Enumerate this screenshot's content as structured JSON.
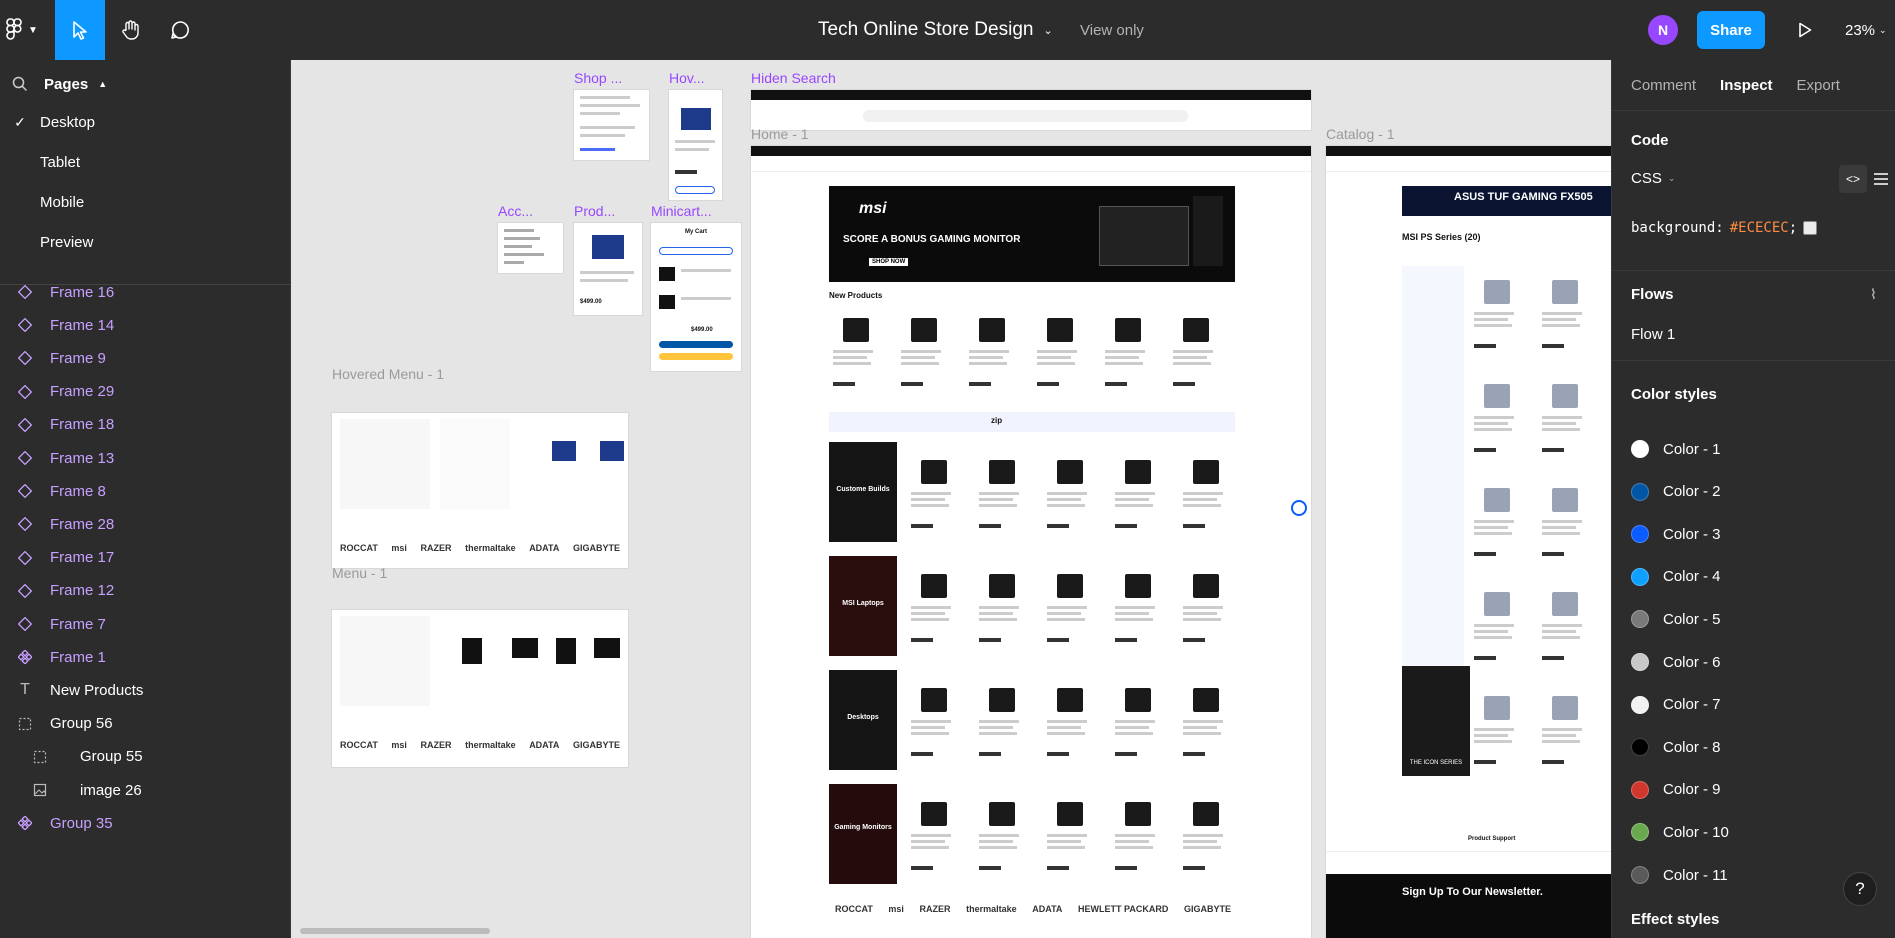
{
  "toolbar": {
    "title": "Tech Online Store Design",
    "view_mode": "View only",
    "avatar_initial": "N",
    "share_label": "Share",
    "zoom": "23%"
  },
  "pages": {
    "header": "Pages",
    "items": [
      "Desktop",
      "Tablet",
      "Mobile",
      "Preview"
    ],
    "selected": "Desktop"
  },
  "layers": [
    {
      "label": "Frame 16",
      "type": "frame"
    },
    {
      "label": "Frame 14",
      "type": "frame"
    },
    {
      "label": "Frame 9",
      "type": "frame"
    },
    {
      "label": "Frame 29",
      "type": "frame"
    },
    {
      "label": "Frame 18",
      "type": "frame"
    },
    {
      "label": "Frame 13",
      "type": "frame"
    },
    {
      "label": "Frame 8",
      "type": "frame"
    },
    {
      "label": "Frame 28",
      "type": "frame"
    },
    {
      "label": "Frame 17",
      "type": "frame"
    },
    {
      "label": "Frame 12",
      "type": "frame"
    },
    {
      "label": "Frame 7",
      "type": "frame"
    },
    {
      "label": "Frame 1",
      "type": "component"
    },
    {
      "label": "New Products",
      "type": "text"
    },
    {
      "label": "Group 56",
      "type": "group"
    },
    {
      "label": "Group 55",
      "type": "group"
    },
    {
      "label": "image 26",
      "type": "image"
    },
    {
      "label": "Group 35",
      "type": "component"
    }
  ],
  "canvas": {
    "labels": {
      "shop": "Shop ...",
      "hov": "Hov...",
      "hidden_search": "Hiden Search",
      "home": "Home - 1",
      "catalog": "Catalog - 1",
      "acc": "Acc...",
      "prod": "Prod...",
      "minicart": "Minicart...",
      "hovered_menu": "Hovered Menu - 1",
      "menu": "Menu - 1"
    },
    "home": {
      "banner_brand": "msi",
      "banner_headline": "SCORE A BONUS GAMING MONITOR",
      "banner_cta": "SHOP NOW",
      "new_products": "New Products",
      "custom_builds": "Custome Builds",
      "msi_laptops": "MSI Laptops",
      "desktops": "Desktops",
      "gaming_monitors": "Gaming Monitors",
      "zip_text": "zip"
    },
    "catalog": {
      "banner": "ASUS TUF GAMING FX505",
      "heading": "MSI PS Series (20)",
      "newsletter": "Sign Up To Our Newsletter.",
      "product_support": "Product Support",
      "icon_series": "THE ICON SERIES"
    },
    "minicart": {
      "title": "My Cart",
      "total": "$499.00"
    },
    "product_price": "$499.00",
    "brand_logos": [
      "ROCCAT",
      "msi",
      "RAZER",
      "thermaltake",
      "ADATA",
      "HEWLETT PACKARD",
      "GIGABYTE"
    ]
  },
  "inspect": {
    "tabs": [
      "Comment",
      "Inspect",
      "Export"
    ],
    "active_tab": "Inspect",
    "code_title": "Code",
    "code_lang": "CSS",
    "code_prop": "background:",
    "code_value": "#ECECEC",
    "code_end": ";",
    "flows_title": "Flows",
    "flow_item": "Flow 1",
    "color_styles_title": "Color styles",
    "effect_styles_title": "Effect styles",
    "colors": [
      {
        "name": "Color - 1",
        "hex": "#ffffff"
      },
      {
        "name": "Color - 2",
        "hex": "#0156a6"
      },
      {
        "name": "Color - 3",
        "hex": "#0a5cff"
      },
      {
        "name": "Color - 4",
        "hex": "#0fa0ff"
      },
      {
        "name": "Color - 5",
        "hex": "#7a7a7a"
      },
      {
        "name": "Color - 6",
        "hex": "#c8c8c8"
      },
      {
        "name": "Color - 7",
        "hex": "#f2f2f2"
      },
      {
        "name": "Color - 8",
        "hex": "#000000"
      },
      {
        "name": "Color - 9",
        "hex": "#d0382e"
      },
      {
        "name": "Color - 10",
        "hex": "#6aa84f"
      },
      {
        "name": "Color - 11",
        "hex": "#5a5a5a"
      }
    ]
  },
  "colors": {
    "accent": "#0d99ff",
    "component": "#9747ff",
    "panel": "#2c2c2c",
    "canvas": "#e5e5e5"
  }
}
